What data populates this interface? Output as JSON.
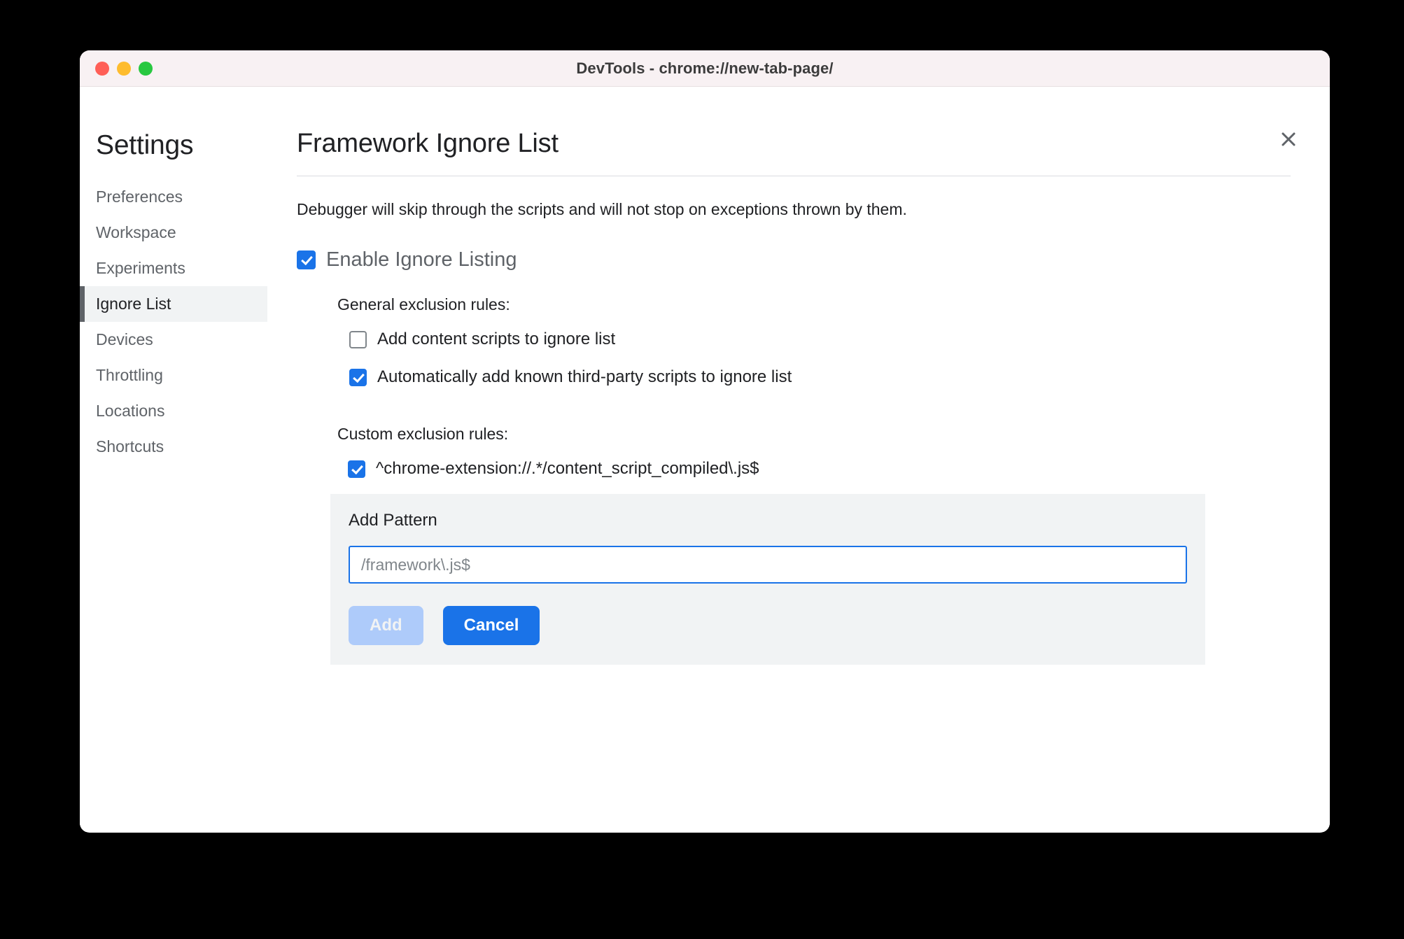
{
  "window": {
    "title": "DevTools - chrome://new-tab-page/",
    "traffic_lights": {
      "close": "close-window-button",
      "minimize": "minimize-window-button",
      "zoom": "zoom-window-button"
    }
  },
  "sidebar": {
    "title": "Settings",
    "items": [
      {
        "label": "Preferences",
        "selected": false
      },
      {
        "label": "Workspace",
        "selected": false
      },
      {
        "label": "Experiments",
        "selected": false
      },
      {
        "label": "Ignore List",
        "selected": true
      },
      {
        "label": "Devices",
        "selected": false
      },
      {
        "label": "Throttling",
        "selected": false
      },
      {
        "label": "Locations",
        "selected": false
      },
      {
        "label": "Shortcuts",
        "selected": false
      }
    ]
  },
  "main": {
    "page_title": "Framework Ignore List",
    "description": "Debugger will skip through the scripts and will not stop on exceptions thrown by them.",
    "enable_ignore_listing": {
      "label": "Enable Ignore Listing",
      "checked": true
    },
    "general_rules": {
      "heading": "General exclusion rules:",
      "items": [
        {
          "label": "Add content scripts to ignore list",
          "checked": false
        },
        {
          "label": "Automatically add known third-party scripts to ignore list",
          "checked": true
        }
      ]
    },
    "custom_rules": {
      "heading": "Custom exclusion rules:",
      "items": [
        {
          "label": "^chrome-extension://.*/content_script_compiled\\.js$",
          "checked": true
        }
      ]
    },
    "add_pattern": {
      "title": "Add Pattern",
      "input_value": "",
      "input_placeholder": "/framework\\.js$",
      "add_label": "Add",
      "add_disabled": true,
      "cancel_label": "Cancel"
    },
    "close_label": "×"
  },
  "colors": {
    "accent": "#1a73e8",
    "accent_disabled": "#aecbfa",
    "panel": "#f1f3f4",
    "text": "#202124",
    "muted_text": "#5f6368",
    "titlebar": "#f8f1f3"
  }
}
